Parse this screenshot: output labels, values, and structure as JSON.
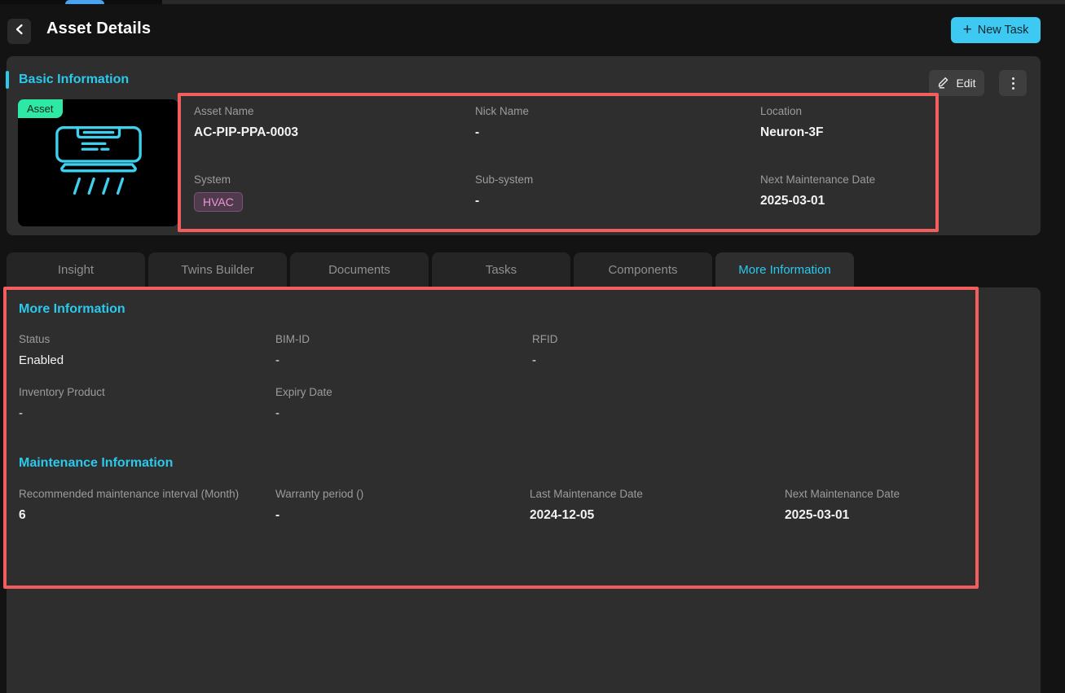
{
  "header": {
    "title": "Asset Details",
    "new_task_plus": "+",
    "new_task_label": "New Task"
  },
  "basic_info": {
    "heading": "Basic Information",
    "edit_label": "Edit",
    "image_badge": "Asset",
    "fields": [
      {
        "label": "Asset Name",
        "value": "AC-PIP-PPA-0003"
      },
      {
        "label": "Nick Name",
        "value": "-"
      },
      {
        "label": "Location",
        "value": "Neuron-3F"
      },
      {
        "label": "System",
        "value": "HVAC"
      },
      {
        "label": "Sub-system",
        "value": "-"
      },
      {
        "label": "Next Maintenance Date",
        "value": "2025-03-01"
      }
    ]
  },
  "tabs": [
    {
      "label": "Insight",
      "active": false
    },
    {
      "label": "Twins Builder",
      "active": false
    },
    {
      "label": "Documents",
      "active": false
    },
    {
      "label": "Tasks",
      "active": false
    },
    {
      "label": "Components",
      "active": false
    },
    {
      "label": "More Information",
      "active": true
    }
  ],
  "more_info": {
    "heading": "More Information",
    "fields": [
      {
        "label": "Status",
        "value": "Enabled"
      },
      {
        "label": "BIM-ID",
        "value": "-"
      },
      {
        "label": "RFID",
        "value": "-"
      },
      {
        "label": "Inventory Product",
        "value": "-"
      },
      {
        "label": "Expiry Date",
        "value": "-"
      }
    ]
  },
  "maintenance_info": {
    "heading": "Maintenance Information",
    "fields": [
      {
        "label": "Recommended maintenance interval (Month)",
        "value": "6"
      },
      {
        "label": "Warranty period ()",
        "value": "-"
      },
      {
        "label": "Last Maintenance Date",
        "value": "2024-12-05"
      },
      {
        "label": "Next Maintenance Date",
        "value": "2025-03-01"
      }
    ]
  },
  "colors": {
    "accent_cyan": "#2bc9ec",
    "button_cyan": "#3ec9f3",
    "badge_green": "#2ee8a5",
    "hvac_pink": "#f093d9",
    "hvac_bg": "#4f3b4c",
    "annotation_red": "#f25e5e",
    "tab_indicator_blue": "#47a4f5"
  }
}
